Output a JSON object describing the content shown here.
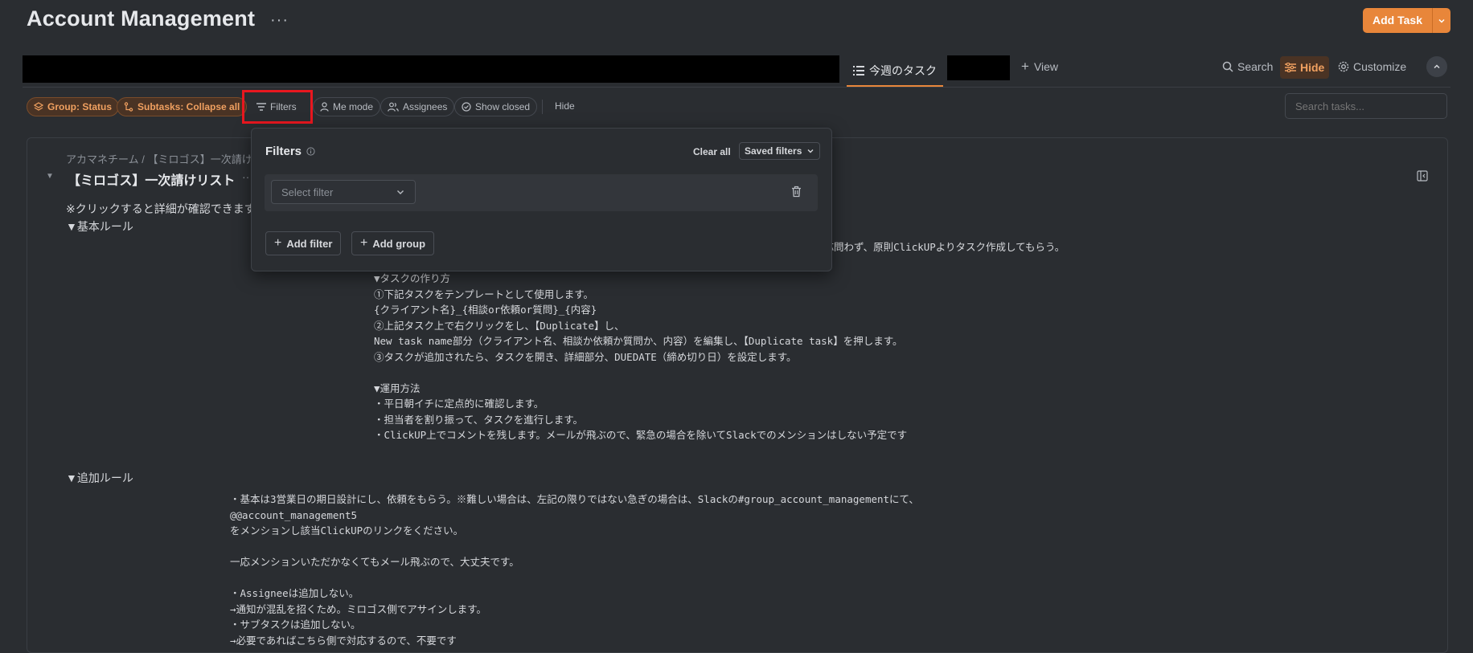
{
  "header": {
    "title": "Account Management",
    "more": "···",
    "add_task": "Add Task"
  },
  "tabs": {
    "active": "今週のタスク",
    "add_view": "View"
  },
  "toolbar": {
    "search": "Search",
    "hide": "Hide",
    "customize": "Customize"
  },
  "filterbar": {
    "group": "Group: Status",
    "subtasks": "Subtasks: Collapse all",
    "filters": "Filters",
    "me_mode": "Me mode",
    "assignees": "Assignees",
    "show_closed": "Show closed",
    "hide": "Hide",
    "search_placeholder": "Search tasks..."
  },
  "list": {
    "breadcrumb": "アカマネチーム / 【ミロゴス】一次請けリ",
    "title": "【ミロゴス】一次請けリスト",
    "more": "···"
  },
  "description": {
    "click_note": "※クリックすると詳細が確認できます",
    "basic_rules": "▼基本ルール",
    "line_cut": "対応問わず、原則ClickUPよりタスク作成してもらう。",
    "block1": [
      "▼タスクの作り方",
      "①下記タスクをテンプレートとして使用します。",
      "{クライアント名}_{相談or依頼or質問}_{内容}",
      "②上記タスク上で右クリックをし、【Duplicate】し、",
      "New task name部分（クライアント名、相談か依頼か質問か、内容）を編集し、【Duplicate task】を押します。",
      "③タスクが追加されたら、タスクを開き、詳細部分、DUEDATE（締め切り日）を設定します。",
      "",
      "▼運用方法",
      "・平日朝イチに定点的に確認します。",
      "・担当者を割り振って、タスクを進行します。",
      "・ClickUP上でコメントを残します。メールが飛ぶので、緊急の場合を除いてSlackでのメンションはしない予定です"
    ],
    "additional_rules": "▼追加ルール",
    "block2": [
      "・基本は3営業日の期日設計にし、依頼をもらう。※難しい場合は、左記の限りではない急ぎの場合は、Slackの#group_account_managementにて、",
      "@@account_management5",
      "をメンションし該当ClickUPのリンクをください。",
      "",
      "一応メンションいただかなくてもメール飛ぶので、大丈夫です。",
      "",
      "・Assigneeは追加しない。",
      "→通知が混乱を招くため。ミロゴス側でアサインします。",
      "・サブタスクは追加しない。",
      "→必要であればこちら側で対応するので、不要です"
    ]
  },
  "filters_popup": {
    "title": "Filters",
    "clear_all": "Clear all",
    "saved_filters": "Saved filters",
    "select_placeholder": "Select filter",
    "add_filter": "Add filter",
    "add_group": "Add group"
  },
  "colors": {
    "accent": "#e8863a",
    "highlight": "#e8171f",
    "background": "#2a2d31"
  }
}
